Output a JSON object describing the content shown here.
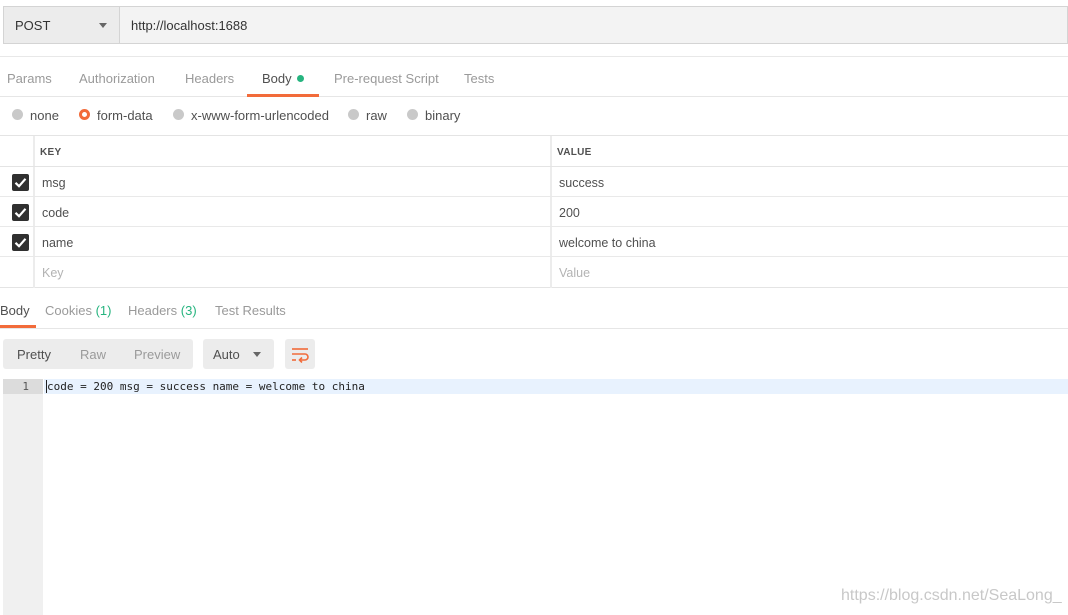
{
  "request": {
    "method": "POST",
    "url": "http://localhost:1688"
  },
  "request_tabs": [
    {
      "label": "Params"
    },
    {
      "label": "Authorization"
    },
    {
      "label": "Headers"
    },
    {
      "label": "Body",
      "active": true
    },
    {
      "label": "Pre-request Script"
    },
    {
      "label": "Tests"
    }
  ],
  "body_types": [
    {
      "label": "none",
      "checked": false
    },
    {
      "label": "form-data",
      "checked": true
    },
    {
      "label": "x-www-form-urlencoded",
      "checked": false
    },
    {
      "label": "raw",
      "checked": false
    },
    {
      "label": "binary",
      "checked": false
    }
  ],
  "form": {
    "key_header": "KEY",
    "value_header": "VALUE",
    "rows": [
      {
        "key": "msg",
        "value": "success",
        "enabled": true
      },
      {
        "key": "code",
        "value": "200",
        "enabled": true
      },
      {
        "key": "name",
        "value": "welcome to china",
        "enabled": true
      }
    ],
    "key_placeholder": "Key",
    "value_placeholder": "Value"
  },
  "response_tabs": [
    {
      "label": "Body",
      "active": true
    },
    {
      "label": "Cookies",
      "count": "(1)"
    },
    {
      "label": "Headers",
      "count": "(3)"
    },
    {
      "label": "Test Results"
    }
  ],
  "view_modes": [
    "Pretty",
    "Raw",
    "Preview"
  ],
  "format": "Auto",
  "response_body": {
    "line_number": "1",
    "text": "code = 200 msg = success name = welcome to china"
  },
  "watermark": "https://blog.csdn.net/SeaLong_",
  "colors": {
    "accent": "#f26b3a",
    "success": "#26b47f"
  }
}
